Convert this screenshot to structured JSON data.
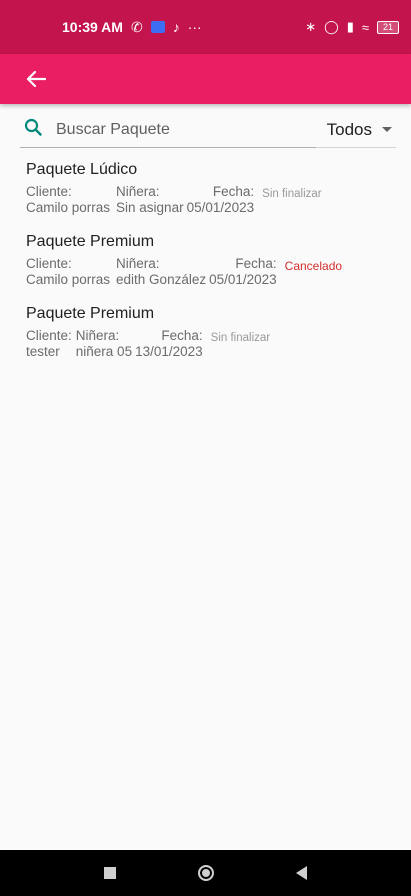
{
  "status_bar": {
    "time": "10:39 AM",
    "battery": "21",
    "more": "···"
  },
  "colors": {
    "status_bar": "#c4144d",
    "app_bar": "#e91e63",
    "search_icon": "#00897b",
    "cancelled": "#d32f2f"
  },
  "search": {
    "placeholder": "Buscar Paquete",
    "value": ""
  },
  "filter": {
    "selected": "Todos"
  },
  "packages": [
    {
      "title": "Paquete Lúdico",
      "cliente_label": "Cliente:",
      "cliente": "Camilo porras",
      "ninera_label": "Niñera:",
      "ninera": "Sin asignar",
      "fecha_label": "Fecha:",
      "fecha": "05/01/2023",
      "status": "Sin finalizar"
    },
    {
      "title": "Paquete Premium",
      "cliente_label": "Cliente:",
      "cliente": "Camilo porras",
      "ninera_label": "Niñera:",
      "ninera": "edith González",
      "fecha_label": "Fecha:",
      "fecha": "05/01/2023",
      "status": "Cancelado"
    },
    {
      "title": "Paquete Premium",
      "cliente_label": "Cliente:",
      "cliente": "tester",
      "ninera_label": "Niñera:",
      "ninera": "niñera 05",
      "fecha_label": "Fecha:",
      "fecha": "13/01/2023",
      "status": "Sin finalizar"
    }
  ]
}
